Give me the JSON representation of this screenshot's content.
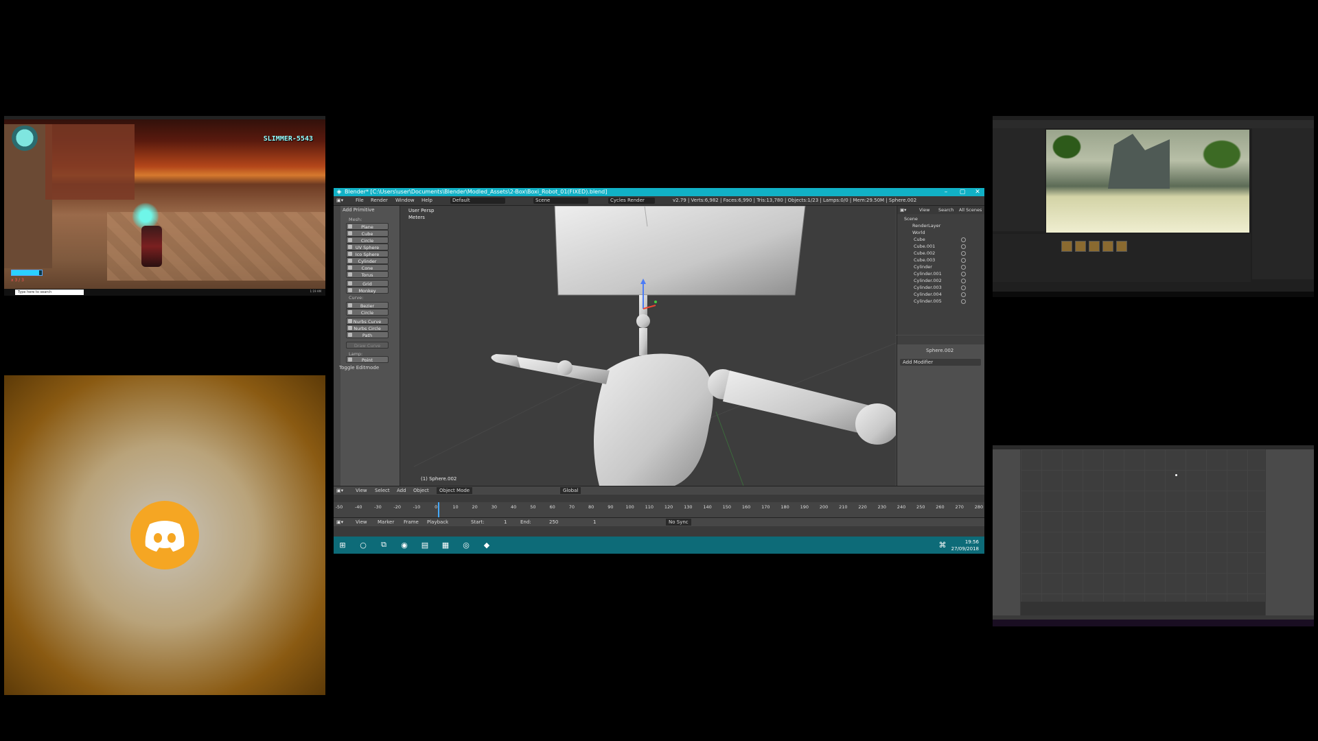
{
  "game": {
    "window_title": "",
    "player_name": "SLIMMER-5543",
    "lives_text": "x 3 / 3",
    "health_fraction": 0.9,
    "taskbar_search": "Type here to search",
    "clock": "1:19 AM"
  },
  "discord": {
    "icon": "discord-logo"
  },
  "blender": {
    "title": "Blender* [C:\\Users\\user\\Documents\\Blender\\Modled_Assets\\2-Box\\Boxi_Robot_01(FIXED).blend]",
    "menu": [
      "File",
      "Render",
      "Window",
      "Help"
    ],
    "layout": "Default",
    "scene": "Scene",
    "engine": "Cycles Render",
    "stats": "v2.79 | Verts:6,982 | Faces:6,990 | Tris:13,780 | Objects:1/23 | Lamps:0/0 | Mem:29.50M | Sphere.002",
    "tool_shelf": {
      "header": "Add Primitive",
      "mesh_label": "Mesh:",
      "mesh_items": [
        "Plane",
        "Cube",
        "Circle",
        "UV Sphere",
        "Ico Sphere",
        "Cylinder",
        "Cone",
        "Torus",
        "Grid",
        "Monkey"
      ],
      "curve_label": "Curve:",
      "curve_items": [
        "Bezier",
        "Circle",
        "Nurbs Curve",
        "Nurbs Circle",
        "Path"
      ],
      "draw_curve": "Draw Curve",
      "lamp_label": "Lamp:",
      "lamp_items": [
        "Point"
      ],
      "toggle": "Toggle Editmode"
    },
    "viewport": {
      "view_name": "User Persp",
      "units": "Meters",
      "selected": "(1) Sphere.002"
    },
    "outliner": {
      "tabs": [
        "View",
        "Search",
        "All Scenes"
      ],
      "rows": [
        "Scene",
        "RenderLayer",
        "World",
        "Cube",
        "Cube.001",
        "Cube.002",
        "Cube.003",
        "Cylinder",
        "Cylinder.001",
        "Cylinder.002",
        "Cylinder.003",
        "Cylinder.004",
        "Cylinder.005"
      ]
    },
    "properties": {
      "object": "Sphere.002",
      "add_modifier": "Add Modifier"
    },
    "view_header": {
      "items": [
        "View",
        "Select",
        "Add",
        "Object"
      ],
      "mode": "Object Mode",
      "orientation": "Global"
    },
    "ruler": [
      -50,
      -40,
      -30,
      -20,
      -10,
      0,
      10,
      20,
      30,
      40,
      50,
      60,
      70,
      80,
      90,
      100,
      110,
      120,
      130,
      140,
      150,
      160,
      170,
      180,
      190,
      200,
      210,
      220,
      230,
      240,
      250,
      260,
      270,
      280
    ],
    "timeline_header": {
      "items": [
        "View",
        "Marker",
        "Frame",
        "Playback"
      ],
      "start": "Start:",
      "start_val": "1",
      "end": "End:",
      "end_val": "250",
      "current": "1",
      "sync": "No Sync"
    },
    "taskbar": {
      "time": "19:56",
      "date": "27/09/2018"
    }
  },
  "unreal": {},
  "blender2": {}
}
